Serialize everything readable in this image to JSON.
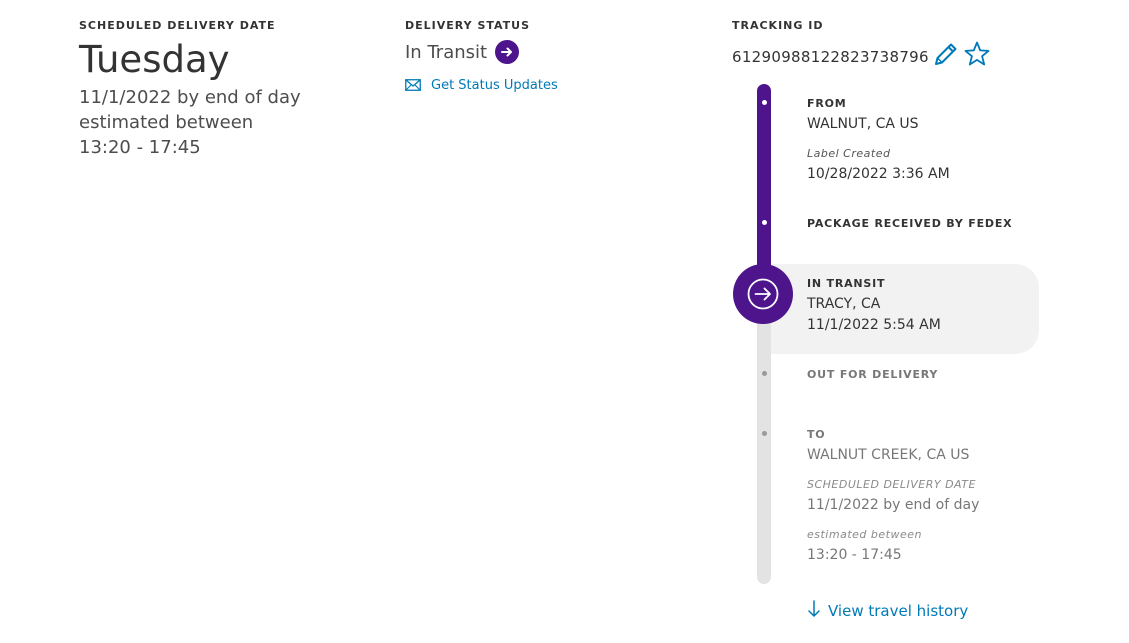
{
  "delivery": {
    "label": "SCHEDULED DELIVERY DATE",
    "day": "Tuesday",
    "date_line": "11/1/2022 by end of day",
    "estimated_label": "estimated between",
    "time_range": "13:20 - 17:45"
  },
  "status": {
    "label": "DELIVERY STATUS",
    "value": "In Transit",
    "updates_link": "Get Status Updates"
  },
  "tracking": {
    "label": "TRACKING ID",
    "id": "61290988122823738796"
  },
  "timeline": {
    "from": {
      "title": "FROM",
      "location": "WALNUT, CA US",
      "sub_label": "Label Created",
      "sub_value": "10/28/2022 3:36 AM"
    },
    "received": {
      "title": "PACKAGE RECEIVED BY FEDEX"
    },
    "current": {
      "title": "IN TRANSIT",
      "location": "TRACY, CA",
      "time": "11/1/2022 5:54 AM"
    },
    "out_for_delivery": {
      "title": "OUT FOR DELIVERY"
    },
    "to": {
      "title": "TO",
      "location": "WALNUT CREEK, CA US",
      "sched_label": "SCHEDULED DELIVERY DATE",
      "sched_value": "11/1/2022 by end of day",
      "est_label": "estimated between",
      "est_value": "13:20 - 17:45"
    },
    "history_link": "View travel history"
  },
  "colors": {
    "fedex_purple": "#4d148c",
    "link_blue": "#007ab7",
    "track_gray": "#e3e3e3",
    "current_card_bg": "#f2f2f2"
  },
  "icons": {
    "status_arrow": "arrow-right-circle-icon",
    "envelope": "envelope-icon",
    "edit": "pencil-icon",
    "favorite": "star-outline-icon",
    "history": "arrow-down-icon"
  }
}
